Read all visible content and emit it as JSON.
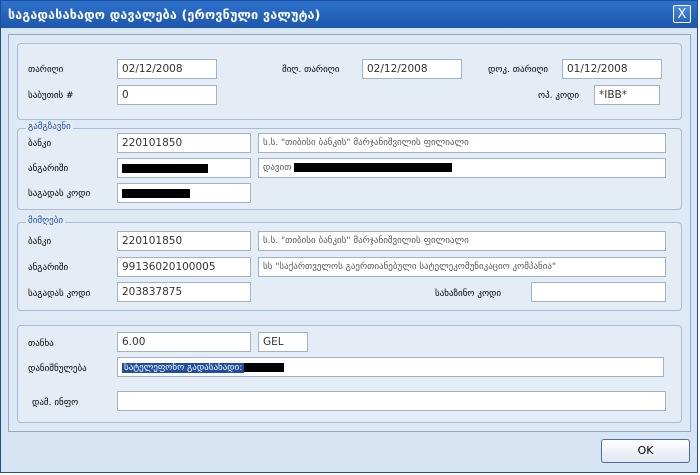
{
  "window": {
    "title": "საგადასახადო დავალება (ეროვნული ვალუტა)",
    "close_label": "X"
  },
  "header": {
    "date_label": "თარიღი",
    "date_value": "02/12/2008",
    "recv_date_label": "მიღ. თარიღი",
    "recv_date_value": "02/12/2008",
    "doc_date_label": "დოკ. თარიღი",
    "doc_date_value": "01/12/2008",
    "doc_no_label": "საბუთის #",
    "doc_no_value": "0",
    "bank_code_label": "ოპ. კოდი",
    "bank_code_value": "*IBB*"
  },
  "sender": {
    "legend": "გამგზავნი",
    "bank_label": "ბანკი",
    "bank_code": "220101850",
    "bank_name": "ს.ს. \"თიბისი ბანკის\" მარჯანიშვილის ფილიალი",
    "account_label": "ანგარიში",
    "name_prefix": "დავით",
    "tax_code_label": "საგადას კოდი"
  },
  "receiver": {
    "legend": "მიმღები",
    "bank_label": "ბანკი",
    "bank_code": "220101850",
    "bank_name": "ს.ს. \"თიბისი ბანკის\" მარჯანიშვილის ფილიალი",
    "account_label": "ანგარიში",
    "account_value": "99136020100005",
    "account_name": "სს \"საქართველოს გაერთიანებული სატელეკომუნიკაციო კომპანია\"",
    "tax_code_label": "საგადას კოდი",
    "tax_code_value": "203837875",
    "treasury_code_label": "სახაზინო კოდი",
    "treasury_code_value": ""
  },
  "payment": {
    "amount_label": "თანხა",
    "amount_value": "6.00",
    "currency_value": "GEL",
    "purpose_label": "დანიშნულება",
    "purpose_value": "სატელეფონო გადასახადი:",
    "extra_info_label": "დამ. ინფო",
    "extra_info_value": ""
  },
  "footer": {
    "ok_label": "OK"
  },
  "colors": {
    "titlebar": "#1d57ad",
    "background": "#d7e4f3",
    "legend": "#1f4fa8",
    "selection": "#1e4f9e"
  }
}
